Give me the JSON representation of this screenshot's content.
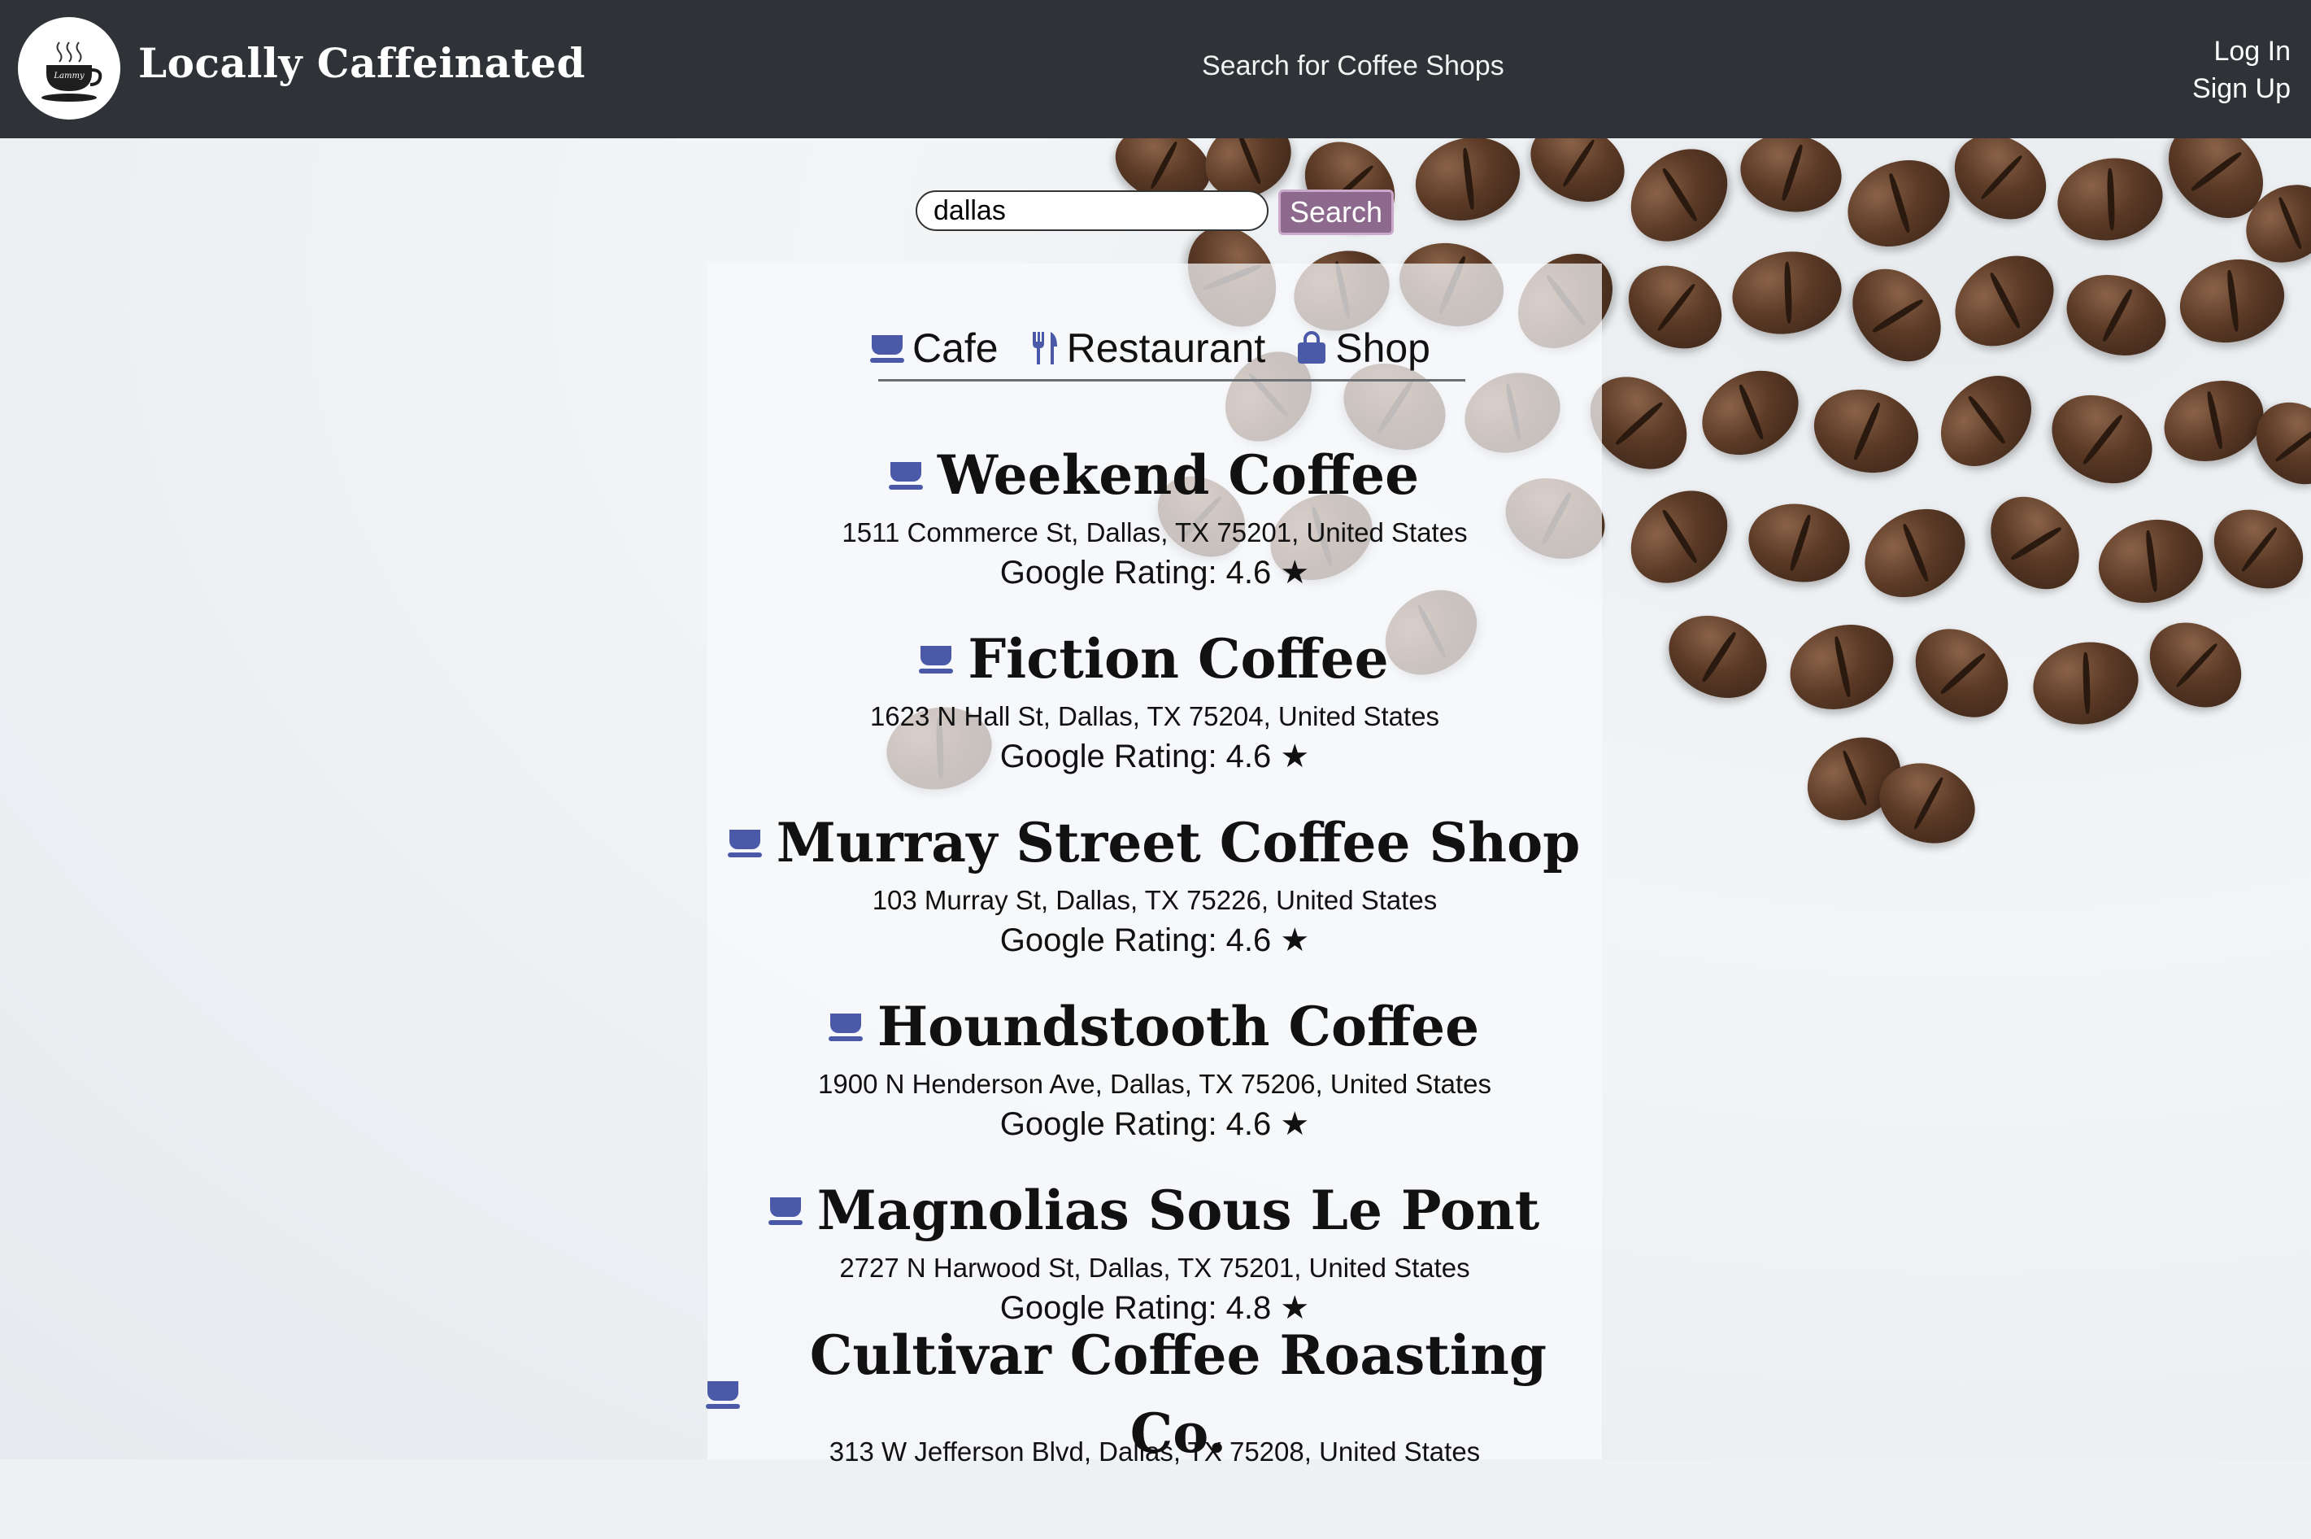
{
  "header": {
    "brand": "Locally Caffeinated",
    "logo_text": "Lammy",
    "nav_search": "Search for Coffee Shops",
    "login": "Log In",
    "signup": "Sign Up"
  },
  "search": {
    "value": "dallas",
    "button": "Search"
  },
  "tabs": [
    {
      "label": "Cafe",
      "icon": "coffee-cup-icon"
    },
    {
      "label": "Restaurant",
      "icon": "fork-knife-icon"
    },
    {
      "label": "Shop",
      "icon": "shopping-bag-icon"
    }
  ],
  "results": [
    {
      "name": "Weekend Coffee",
      "address": "1511 Commerce St, Dallas, TX 75201, United States",
      "rating": "Google Rating: 4.6 ★"
    },
    {
      "name": "Fiction Coffee",
      "address": "1623 N Hall St, Dallas, TX 75204, United States",
      "rating": "Google Rating: 4.6 ★"
    },
    {
      "name": "Murray Street Coffee Shop",
      "address": "103 Murray St, Dallas, TX 75226, United States",
      "rating": "Google Rating: 4.6 ★"
    },
    {
      "name": "Houndstooth Coffee",
      "address": "1900 N Henderson Ave, Dallas, TX 75206, United States",
      "rating": "Google Rating: 4.6 ★"
    },
    {
      "name": "Magnolias Sous Le Pont",
      "address": "2727 N Harwood St, Dallas, TX 75201, United States",
      "rating": "Google Rating: 4.8 ★"
    },
    {
      "name": "Cultivar Coffee Roasting Co.",
      "address": "313 W Jefferson Blvd, Dallas, TX 75208, United States",
      "rating": ""
    }
  ],
  "colors": {
    "header_bg": "#2f3338",
    "accent_icon": "#4a5aa8",
    "search_button": "#8d6a8d"
  }
}
